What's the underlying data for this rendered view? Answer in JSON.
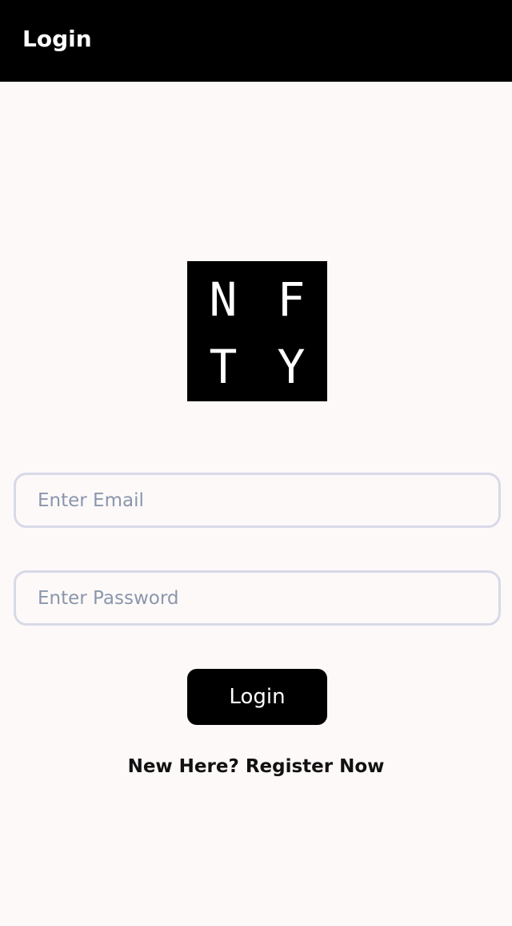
{
  "app_bar": {
    "title": "Login"
  },
  "logo": {
    "letters": [
      "N",
      "F",
      "T",
      "Y"
    ]
  },
  "form": {
    "email_placeholder": "Enter Email",
    "email_value": "",
    "password_placeholder": "Enter Password",
    "password_value": "",
    "submit_label": "Login"
  },
  "register": {
    "label": "New Here? Register Now"
  },
  "colors": {
    "app_bar_background": "#000000",
    "page_background": "#fdf9f8",
    "field_border": "#d8d9e8",
    "placeholder_text": "#8a96ad",
    "button_background": "#000000",
    "button_text": "#ffffff"
  }
}
